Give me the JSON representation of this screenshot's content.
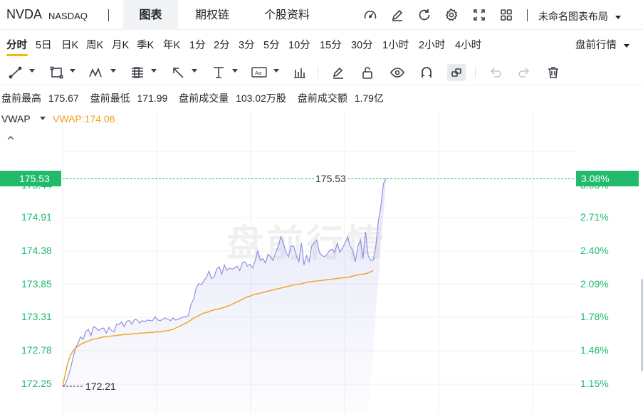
{
  "header": {
    "symbol": "NVDA",
    "exchange": "NASDAQ",
    "tabs": [
      {
        "label": "图表",
        "active": true
      },
      {
        "label": "期权链",
        "active": false
      },
      {
        "label": "个股资料",
        "active": false
      }
    ],
    "icons": [
      "speedometer-icon",
      "pencil-icon",
      "refresh-icon",
      "gear-icon",
      "fullscreen-icon",
      "grid-icon"
    ],
    "layout_label": "未命名图表布局"
  },
  "periods": [
    "分时",
    "5日",
    "日K",
    "周K",
    "月K",
    "季K",
    "年K",
    "1分",
    "2分",
    "3分",
    "5分",
    "10分",
    "15分",
    "30分",
    "1小时",
    "2小时",
    "4小时"
  ],
  "active_period": "分时",
  "session_label": "盘前行情",
  "toolbar": {
    "icons": [
      "trend-line-icon",
      "rectangle-icon",
      "pattern-icon",
      "fibonacci-icon",
      "arrow-icon",
      "text-icon",
      "annotation-icon",
      "volume-bars-icon",
      "eraser-icon",
      "lock-icon",
      "eye-icon",
      "magnet-icon",
      "link-icon",
      "undo-icon",
      "redo-icon",
      "trash-icon"
    ],
    "active_tool": "link-icon"
  },
  "stats": [
    {
      "label": "盘前最高",
      "value": "175.67"
    },
    {
      "label": "盘前最低",
      "value": "171.99"
    },
    {
      "label": "盘前成交量",
      "value": "103.02万股"
    },
    {
      "label": "盘前成交额",
      "value": "1.79亿"
    }
  ],
  "indicator": {
    "name": "VWAP",
    "value_text": "VWAP:174.06"
  },
  "watermark": "盘前行情",
  "colors": {
    "up_green": "#22bb6c",
    "price_line": "#8e92e0",
    "vwap_line": "#f29f1c",
    "tab_active_bg": "#f2f3f5",
    "period_underline": "#f0b90b"
  },
  "chart_data": {
    "type": "line",
    "last_price": "175.53",
    "last_change_pct": "3.08%",
    "low_marker": "172.21",
    "y_ticks": [
      "174.91",
      "174.38",
      "173.85",
      "173.31",
      "172.78",
      "172.25"
    ],
    "pct_ticks": [
      "2.71%",
      "2.40%",
      "2.09%",
      "1.78%",
      "1.46%",
      "1.15%"
    ],
    "hidden_y_tick": "175.44",
    "hidden_pct_tick": "3.03%",
    "ylim": [
      172.05,
      175.75
    ],
    "x_count": 120,
    "series": [
      {
        "name": "",
        "values": [
          172.21,
          172.24,
          172.35,
          172.48,
          172.66,
          172.82,
          172.9,
          173.0,
          172.96,
          173.08,
          173.12,
          173.02,
          173.16,
          173.14,
          173.1,
          173.13,
          173.14,
          173.06,
          173.15,
          173.1,
          173.08,
          173.2,
          173.2,
          173.24,
          173.16,
          173.25,
          173.26,
          173.2,
          173.28,
          173.27,
          173.22,
          173.26,
          173.24,
          173.27,
          173.26,
          173.26,
          173.32,
          173.27,
          173.26,
          173.28,
          173.3,
          173.28,
          173.26,
          173.3,
          173.27,
          173.28,
          173.3,
          173.32,
          173.32,
          173.34,
          173.52,
          173.6,
          173.78,
          173.85,
          173.83,
          173.9,
          173.95,
          174.05,
          173.93,
          173.96,
          174.08,
          174.12,
          174.0,
          174.15,
          174.06,
          174.1,
          174.08,
          174.1,
          174.13,
          174.06,
          174.18,
          174.2,
          174.13,
          174.16,
          174.1,
          174.22,
          174.38,
          174.22,
          174.25,
          174.18,
          174.32,
          174.28,
          174.22,
          174.35,
          174.45,
          174.6,
          174.5,
          174.35,
          174.28,
          174.45,
          174.45,
          174.3,
          174.2,
          174.5,
          174.15,
          174.3,
          174.2,
          174.45,
          174.5,
          174.55,
          174.35,
          174.3,
          174.28,
          174.32,
          174.38,
          174.4,
          174.35,
          174.5,
          174.35,
          174.42,
          174.5,
          174.6,
          174.45,
          174.38,
          174.2,
          174.45,
          174.55,
          174.25,
          174.68,
          174.3,
          174.22,
          174.23,
          174.45,
          174.85,
          175.1,
          175.45,
          175.53
        ]
      },
      {
        "name": "VWAP",
        "values": [
          172.21,
          172.4,
          172.58,
          172.7,
          172.77,
          172.82,
          172.85,
          172.88,
          172.9,
          172.92,
          172.93,
          172.95,
          172.96,
          172.97,
          172.98,
          172.99,
          173.0,
          173.0,
          173.01,
          173.01,
          173.02,
          173.02,
          173.03,
          173.03,
          173.04,
          173.04,
          173.04,
          173.05,
          173.05,
          173.05,
          173.06,
          173.06,
          173.06,
          173.07,
          173.07,
          173.07,
          173.08,
          173.08,
          173.08,
          173.09,
          173.09,
          173.1,
          173.11,
          173.12,
          173.14,
          173.16,
          173.18,
          173.2,
          173.22,
          173.24,
          173.27,
          173.3,
          173.32,
          173.34,
          173.36,
          173.38,
          173.39,
          173.4,
          173.42,
          173.43,
          173.44,
          173.45,
          173.46,
          173.47,
          173.49,
          173.5,
          173.52,
          173.54,
          173.56,
          173.58,
          173.6,
          173.62,
          173.64,
          173.65,
          173.67,
          173.68,
          173.69,
          173.7,
          173.71,
          173.72,
          173.73,
          173.74,
          173.75,
          173.76,
          173.77,
          173.78,
          173.79,
          173.8,
          173.81,
          173.82,
          173.83,
          173.84,
          173.84,
          173.85,
          173.86,
          173.87,
          173.88,
          173.88,
          173.89,
          173.89,
          173.9,
          173.9,
          173.91,
          173.91,
          173.92,
          173.92,
          173.93,
          173.93,
          173.94,
          173.94,
          173.95,
          173.95,
          173.96,
          173.97,
          173.98,
          173.99,
          174.0,
          174.0,
          174.01,
          174.02,
          174.04,
          174.06
        ]
      }
    ]
  }
}
